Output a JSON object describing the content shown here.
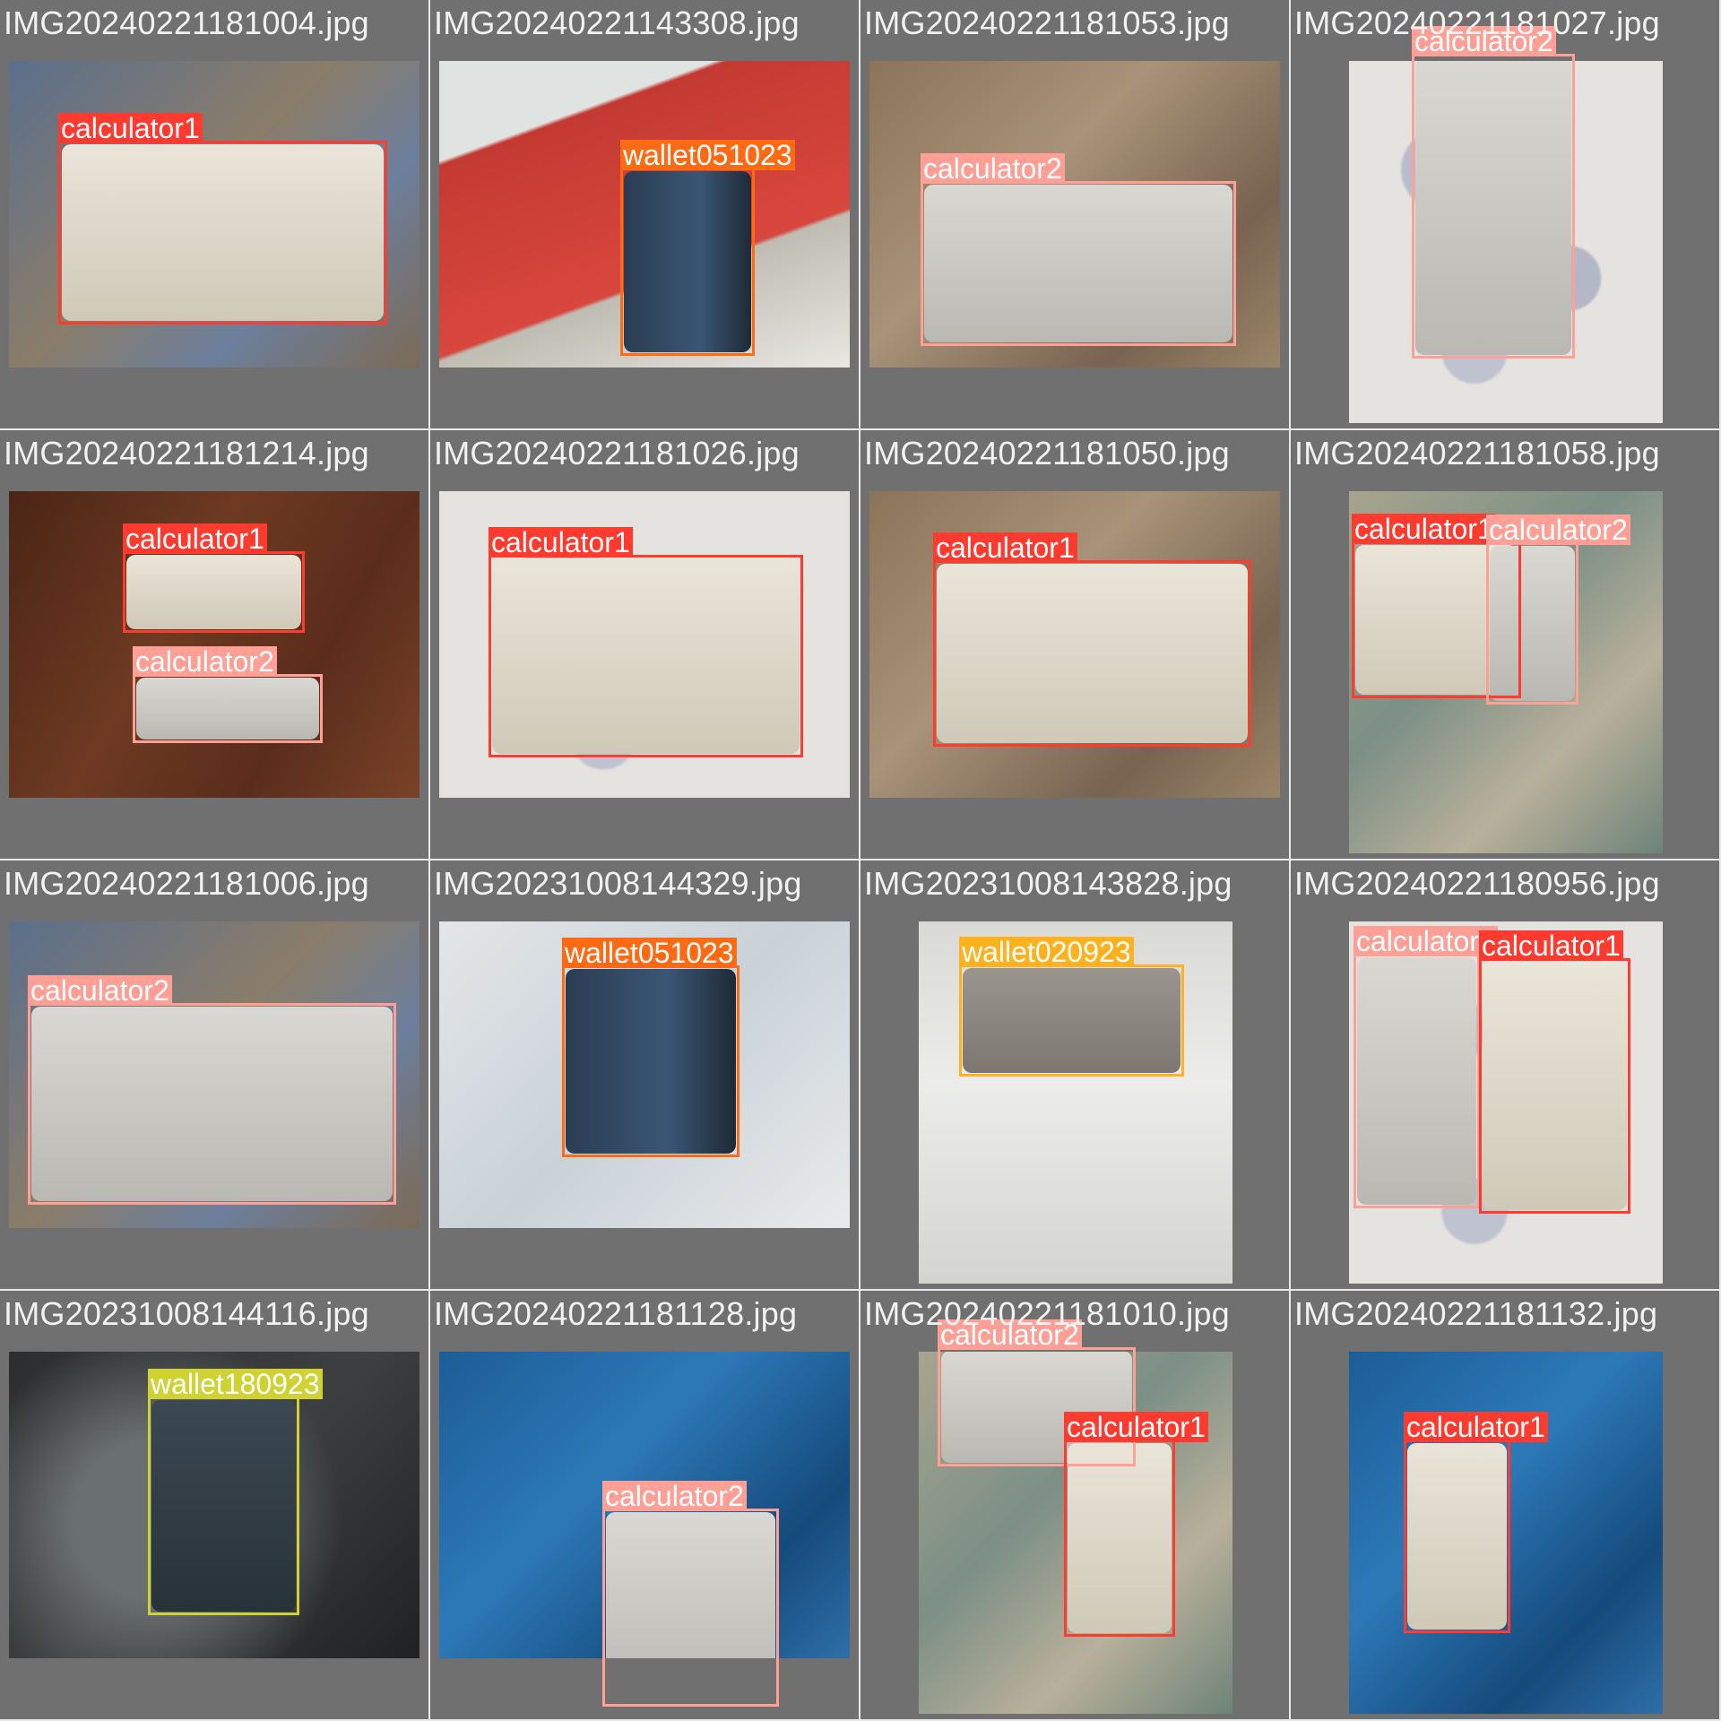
{
  "classes": {
    "calculator1": {
      "color": "#ff3b30",
      "text_color": "#ffffff"
    },
    "calculator2": {
      "color": "#ff9f96",
      "text_color": "#ffffff"
    },
    "wallet051023": {
      "color": "#ff6a13",
      "text_color": "#ffffff"
    },
    "wallet020923": {
      "color": "#ffb21d",
      "text_color": "#ffffff"
    },
    "wallet180923": {
      "color": "#cfd231",
      "text_color": "#ffffff"
    }
  },
  "tiles": [
    {
      "filename": "IMG20240221181004.jpg",
      "scene": "rug-blue",
      "detections": [
        {
          "label": "calculator1"
        }
      ]
    },
    {
      "filename": "IMG20240221143308.jpg",
      "scene": "red-stool",
      "detections": [
        {
          "label": "wallet051023"
        }
      ]
    },
    {
      "filename": "IMG20240221181053.jpg",
      "scene": "rug-brown",
      "detections": [
        {
          "label": "calculator2"
        }
      ]
    },
    {
      "filename": "IMG20240221181027.jpg",
      "scene": "pebble-floor",
      "detections": [
        {
          "label": "calculator2"
        }
      ]
    },
    {
      "filename": "IMG20240221181214.jpg",
      "scene": "wood-table",
      "detections": [
        {
          "label": "calculator1"
        },
        {
          "label": "calculator2"
        }
      ]
    },
    {
      "filename": "IMG20240221181026.jpg",
      "scene": "pebble-floor",
      "detections": [
        {
          "label": "calculator1"
        }
      ]
    },
    {
      "filename": "IMG20240221181050.jpg",
      "scene": "rug-brown",
      "detections": [
        {
          "label": "calculator1"
        }
      ]
    },
    {
      "filename": "IMG20240221181058.jpg",
      "scene": "rug-green",
      "detections": [
        {
          "label": "calculator1"
        },
        {
          "label": "calculator2"
        }
      ]
    },
    {
      "filename": "IMG20240221181006.jpg",
      "scene": "rug-blue",
      "detections": [
        {
          "label": "calculator2"
        }
      ]
    },
    {
      "filename": "IMG20231008144329.jpg",
      "scene": "glass-tiles",
      "detections": [
        {
          "label": "wallet051023"
        }
      ]
    },
    {
      "filename": "IMG20231008143828.jpg",
      "scene": "white-tiles",
      "detections": [
        {
          "label": "wallet020923"
        }
      ]
    },
    {
      "filename": "IMG20240221180956.jpg",
      "scene": "pebble-floor",
      "detections": [
        {
          "label": "calculator2"
        },
        {
          "label": "calculator1"
        }
      ]
    },
    {
      "filename": "IMG20231008144116.jpg",
      "scene": "granite",
      "detections": [
        {
          "label": "wallet180923"
        }
      ]
    },
    {
      "filename": "IMG20240221181128.jpg",
      "scene": "blue-glass",
      "detections": [
        {
          "label": "calculator2"
        }
      ]
    },
    {
      "filename": "IMG20240221181010.jpg",
      "scene": "rug-green",
      "detections": [
        {
          "label": "calculator2"
        },
        {
          "label": "calculator1"
        }
      ]
    },
    {
      "filename": "IMG20240221181132.jpg",
      "scene": "blue-glass",
      "detections": [
        {
          "label": "calculator1"
        }
      ]
    }
  ]
}
